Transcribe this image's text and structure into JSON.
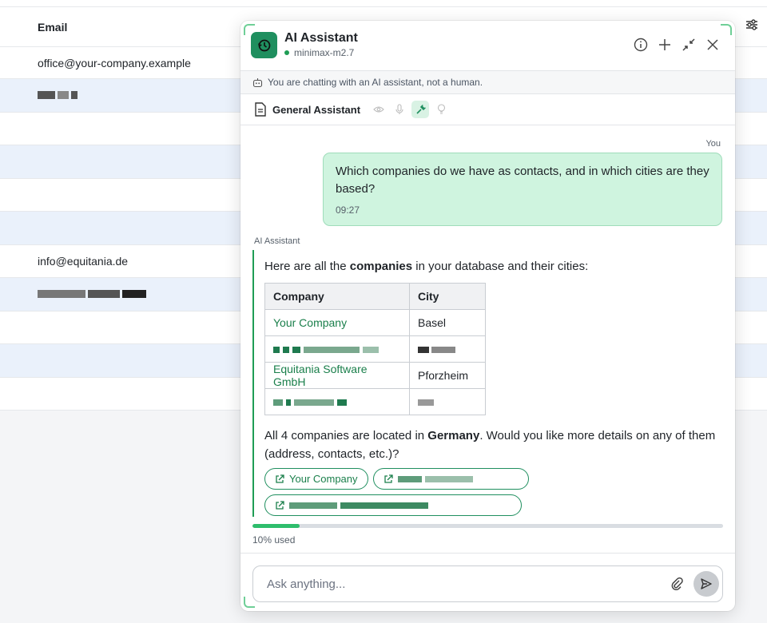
{
  "background_table": {
    "header": "Email",
    "rows": [
      "office@your-company.example",
      "",
      "",
      "",
      "",
      "",
      "info@equitania.de",
      "",
      "",
      "",
      ""
    ]
  },
  "panel": {
    "title": "AI Assistant",
    "model": "minimax-m2.7",
    "notice": "You are chatting with an AI assistant, not a human.",
    "agent_name": "General Assistant",
    "icons": {
      "logo": "history-icon",
      "info": "info-icon",
      "new": "plus-icon",
      "minimize": "minimize-icon",
      "close": "close-icon"
    },
    "colors": {
      "accent": "#1f8f5f",
      "user_bubble": "#cff4df"
    }
  },
  "messages": {
    "you_label": "You",
    "user_text": "Which companies do we have as contacts, and in which cities are they based?",
    "user_time": "09:27",
    "ai_label": "AI Assistant",
    "ai_intro_pre": "Here are all the ",
    "ai_intro_bold": "companies",
    "ai_intro_post": " in your database and their cities:",
    "table": {
      "headers": [
        "Company",
        "City"
      ],
      "rows": [
        {
          "company": "Your Company",
          "city": "Basel"
        },
        {
          "company": "",
          "city": ""
        },
        {
          "company": "Equitania Software GmbH",
          "city": "Pforzheim"
        },
        {
          "company": "",
          "city": ""
        }
      ]
    },
    "summary_pre": "All 4 companies are located in ",
    "summary_bold": "Germany",
    "summary_post": ". Would you like more details on any of them (address, contacts, etc.)?",
    "chips": [
      "Your Company",
      "",
      ""
    ]
  },
  "usage": {
    "percent": 10,
    "label": "10% used"
  },
  "composer": {
    "placeholder": "Ask anything..."
  }
}
